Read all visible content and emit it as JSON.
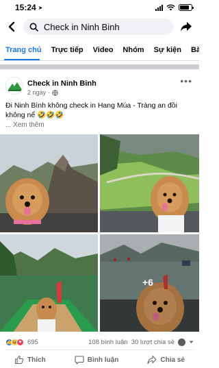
{
  "status": {
    "time": "15:24"
  },
  "search": {
    "query": "Check in Ninh Binh"
  },
  "tabs": [
    "Trang chủ",
    "Trực tiếp",
    "Video",
    "Nhóm",
    "Sự kiện",
    "Bài"
  ],
  "previous_post_actions": [
    "Thích",
    "Bình luận",
    "Chia sẻ"
  ],
  "post": {
    "page_name": "Check in Ninh Binh",
    "time": "2 ngày",
    "text": "Đi Ninh Bình không check in Hang Múa - Tràng an đồi không nể 🤣🤣🤣",
    "see_more": "... Xem thêm",
    "extra_photos": "+6",
    "reaction_count": "695",
    "comments": "108 bình luận",
    "shares": "30 lượt chia sẻ"
  },
  "actions": {
    "like": "Thích",
    "comment": "Bình luận",
    "share": "Chia sẻ"
  },
  "colors": {
    "accent": "#1877f2",
    "secondary_text": "#65676b",
    "separator": "#cacdd1"
  }
}
